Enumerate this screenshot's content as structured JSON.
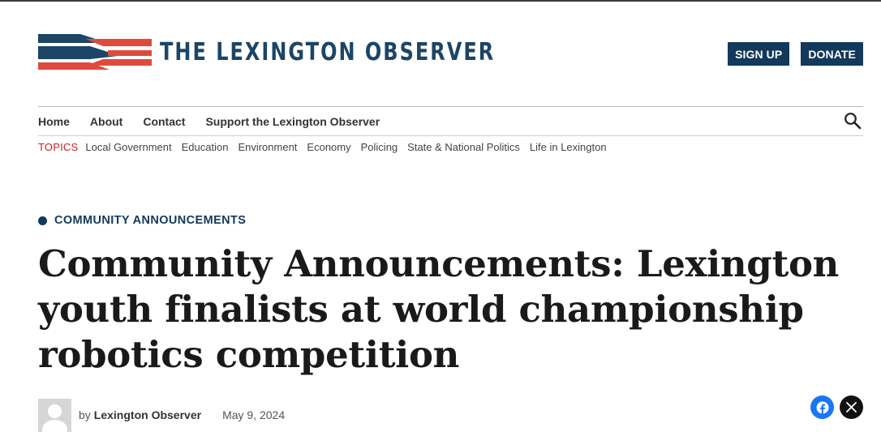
{
  "site": {
    "title": "THE LEXINGTON OBSERVER",
    "colors": {
      "brand_blue": "#13395b",
      "flag_red": "#e04a3c",
      "topics_red": "#c0222c"
    }
  },
  "header": {
    "sign_up_label": "SIGN UP",
    "donate_label": "DONATE"
  },
  "nav": {
    "items": [
      {
        "label": "Home"
      },
      {
        "label": "About"
      },
      {
        "label": "Contact"
      },
      {
        "label": "Support the Lexington Observer"
      }
    ],
    "search_icon": "search-icon"
  },
  "topics": {
    "label": "TOPICS",
    "items": [
      {
        "label": "Local Government"
      },
      {
        "label": "Education"
      },
      {
        "label": "Environment"
      },
      {
        "label": "Economy"
      },
      {
        "label": "Policing"
      },
      {
        "label": "State & National Politics"
      },
      {
        "label": "Life in Lexington"
      }
    ]
  },
  "article": {
    "category": "COMMUNITY ANNOUNCEMENTS",
    "headline": "Community Announcements: Lexington youth finalists at world championship robotics competition",
    "byline_prefix": "by",
    "author": "Lexington Observer",
    "date": "May 9, 2024"
  },
  "share": {
    "facebook_icon": "facebook-icon",
    "x_icon": "x-icon"
  }
}
